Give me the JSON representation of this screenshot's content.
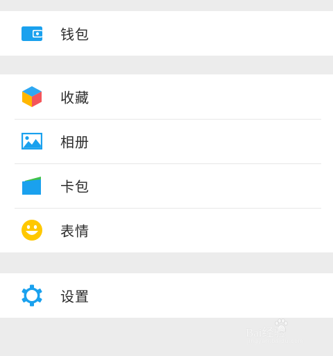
{
  "groups": {
    "wallet": {
      "items": [
        {
          "label": "钱包",
          "icon": "wallet-icon"
        }
      ]
    },
    "main": {
      "items": [
        {
          "label": "收藏",
          "icon": "favorites-cube-icon"
        },
        {
          "label": "相册",
          "icon": "album-picture-icon"
        },
        {
          "label": "卡包",
          "icon": "card-pack-icon"
        },
        {
          "label": "表情",
          "icon": "smiley-face-icon"
        }
      ]
    },
    "settings": {
      "items": [
        {
          "label": "设置",
          "icon": "gear-icon"
        }
      ]
    }
  },
  "colors": {
    "background": "#ececec",
    "row": "#ffffff",
    "divider": "#e7e7e7",
    "text": "#2b2b2b",
    "accent_blue": "#1aa1ee",
    "smiley_yellow": "#ffc800",
    "card_green": "#41c24a"
  },
  "watermark": {
    "text": "Bai经验",
    "sub": "jingyan.baidu.com"
  }
}
